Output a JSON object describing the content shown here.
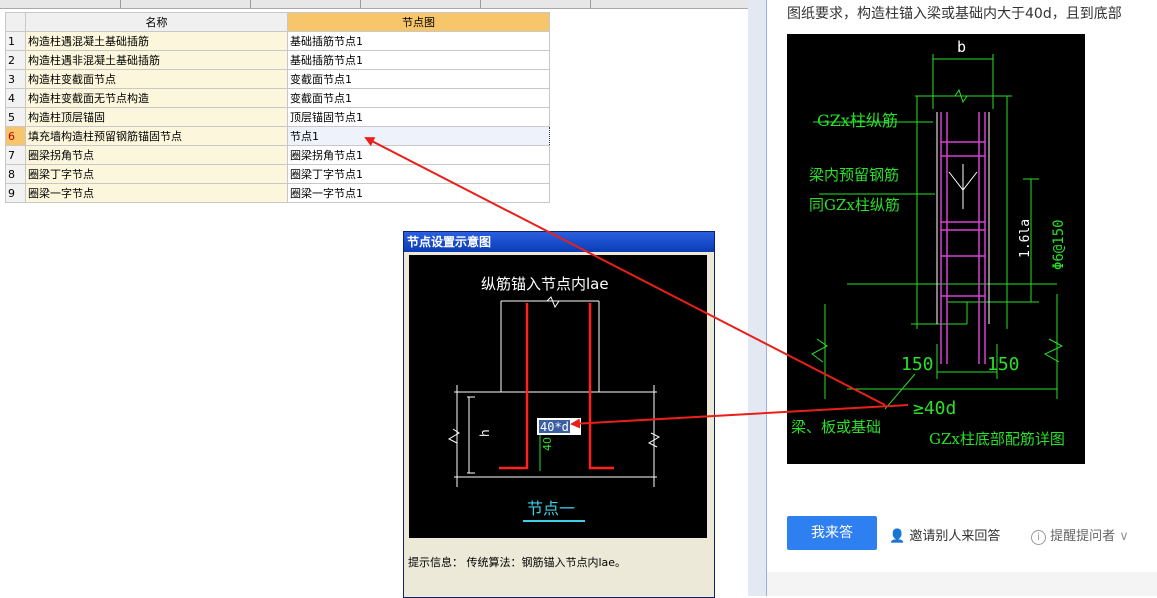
{
  "grid": {
    "headers": {
      "name": "名称",
      "node": "节点图"
    },
    "rows": [
      {
        "num": "1",
        "name": "构造柱遇混凝土基础插筋",
        "node": "基础插筋节点1"
      },
      {
        "num": "2",
        "name": "构造柱遇非混凝土基础插筋",
        "node": "基础插筋节点1"
      },
      {
        "num": "3",
        "name": "构造柱变截面节点",
        "node": "变截面节点1"
      },
      {
        "num": "4",
        "name": "构造柱变截面无节点构造",
        "node": "变截面节点1"
      },
      {
        "num": "5",
        "name": "构造柱顶层锚固",
        "node": "顶层锚固节点1"
      },
      {
        "num": "6",
        "name": "填充墙构造柱预留钢筋锚固节点",
        "node": "节点1"
      },
      {
        "num": "7",
        "name": "圈梁拐角节点",
        "node": "圈梁拐角节点1"
      },
      {
        "num": "8",
        "name": "圈梁丁字节点",
        "node": "圈梁丁字节点1"
      },
      {
        "num": "9",
        "name": "圈梁一字节点",
        "node": "圈梁一字节点1"
      }
    ],
    "selected_row": 6
  },
  "dialog": {
    "title": "节点设置示意图",
    "diagram_title": "纵筋锚入节点内lae",
    "label_h": "h",
    "label_40": "40",
    "input_value": "40*d",
    "caption": "节点一",
    "hint": "提示信息： 传统算法：钢筋锚入节点内lae。"
  },
  "article": {
    "text": "图纸要求，构造柱锚入梁或基础内大于40d，且到底部",
    "cad": {
      "b": "b",
      "gz_bar": "GZx柱纵筋",
      "beam_bar_1": "梁内预留钢筋",
      "beam_bar_2": "同GZx柱纵筋",
      "len": "1.6la",
      "stirrup": "Φ6@150",
      "dim150_left": "150",
      "dim150_right": "150",
      "ge40d": "≥40d",
      "base": "梁、板或基础",
      "detail": "GZx柱底部配筋详图"
    },
    "answer_button": "我来答",
    "invite": "邀请别人来回答",
    "remind": "提醒提问者"
  },
  "colors": {
    "arrow": "#e8201a",
    "cad_green": "#2adf2a",
    "cad_magenta": "#d640d6",
    "button": "#2e7ff0",
    "highlight": "#f7c66b"
  }
}
